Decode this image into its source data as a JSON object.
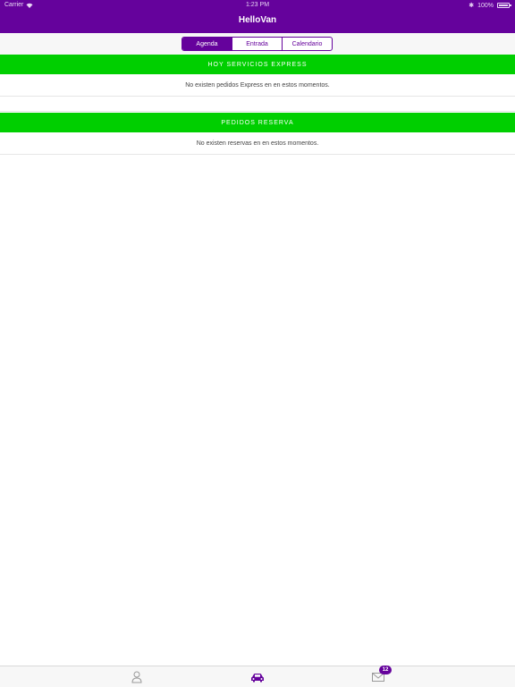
{
  "status_bar": {
    "carrier": "Carrier",
    "time": "1:23 PM",
    "battery": "100%"
  },
  "nav": {
    "title": "HelloVan"
  },
  "segments": [
    {
      "label": "Agenda",
      "active": true
    },
    {
      "label": "Entrada",
      "active": false
    },
    {
      "label": "Calendario",
      "active": false
    }
  ],
  "express": {
    "header": "HOY SERVICIOS EXPRESS",
    "empty": "No existen pedidos Express en en estos momentos."
  },
  "reserva": {
    "header": "PEDIDOS RESERVA",
    "empty": "No existen reservas en en estos momentos."
  },
  "tab_bar": {
    "items": [
      {
        "icon": "user-icon",
        "active": false
      },
      {
        "icon": "car-icon",
        "active": true
      },
      {
        "icon": "mail-icon",
        "active": false,
        "badge": "12"
      }
    ]
  },
  "colors": {
    "brand_purple": "#65029c",
    "section_green": "#00cf00",
    "inactive_icon": "#9a9a9a"
  }
}
